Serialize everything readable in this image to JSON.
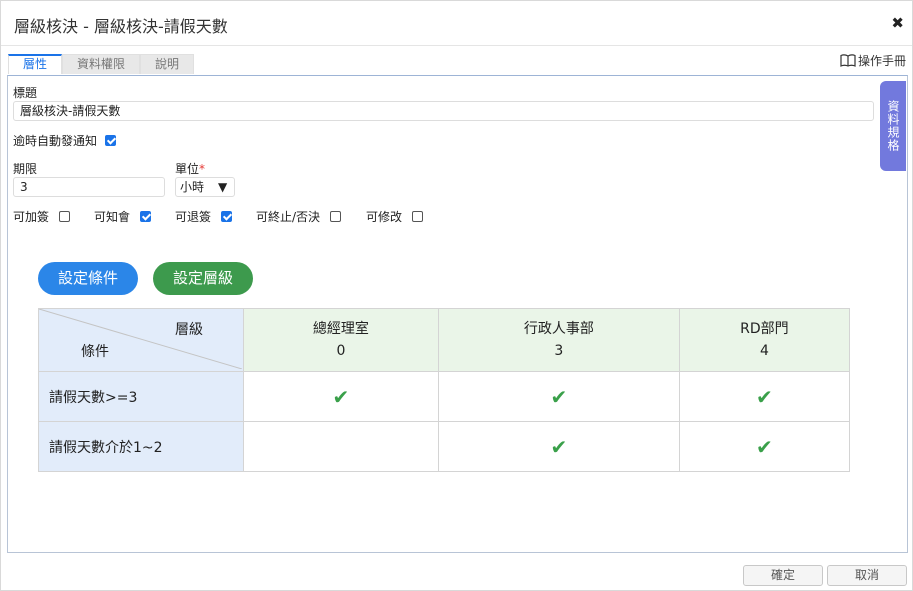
{
  "dialog": {
    "title": "層級核決 - 層級核決-請假天數",
    "close_icon": "close-icon"
  },
  "tabs": [
    {
      "label": "層性",
      "active": true
    },
    {
      "label": "資料權限",
      "active": false
    },
    {
      "label": "說明",
      "active": false
    }
  ],
  "manual": {
    "icon": "book-icon",
    "label": "操作手冊"
  },
  "side_tab": {
    "label": "資料規格"
  },
  "form": {
    "title_label": "標題",
    "title_value": "層級核決-請假天數",
    "auto_notify_label": "逾時自動發通知",
    "auto_notify_checked": true,
    "period_label": "期限",
    "period_value": "3",
    "unit_label": "單位",
    "unit_required": "*",
    "unit_value": "小時",
    "unit_arrow": "▼",
    "options": [
      {
        "label": "可加簽",
        "checked": false
      },
      {
        "label": "可知會",
        "checked": true
      },
      {
        "label": "可退簽",
        "checked": true
      },
      {
        "label": "可終止/否決",
        "checked": false
      },
      {
        "label": "可修改",
        "checked": false
      }
    ]
  },
  "buttons": {
    "set_condition": "設定條件",
    "set_level": "設定層級"
  },
  "grid": {
    "corner_top": "層級",
    "corner_bottom": "條件",
    "columns": [
      {
        "name": "總經理室",
        "level": "0"
      },
      {
        "name": "行政人事部",
        "level": "3"
      },
      {
        "name": "RD部門",
        "level": "4"
      }
    ],
    "rows": [
      {
        "condition": "請假天數>=3",
        "checks": [
          true,
          true,
          true
        ]
      },
      {
        "condition": "請假天數介於1~2",
        "checks": [
          false,
          true,
          true
        ]
      }
    ],
    "check_glyph": "✔"
  },
  "footer": {
    "ok": "確定",
    "cancel": "取消"
  }
}
